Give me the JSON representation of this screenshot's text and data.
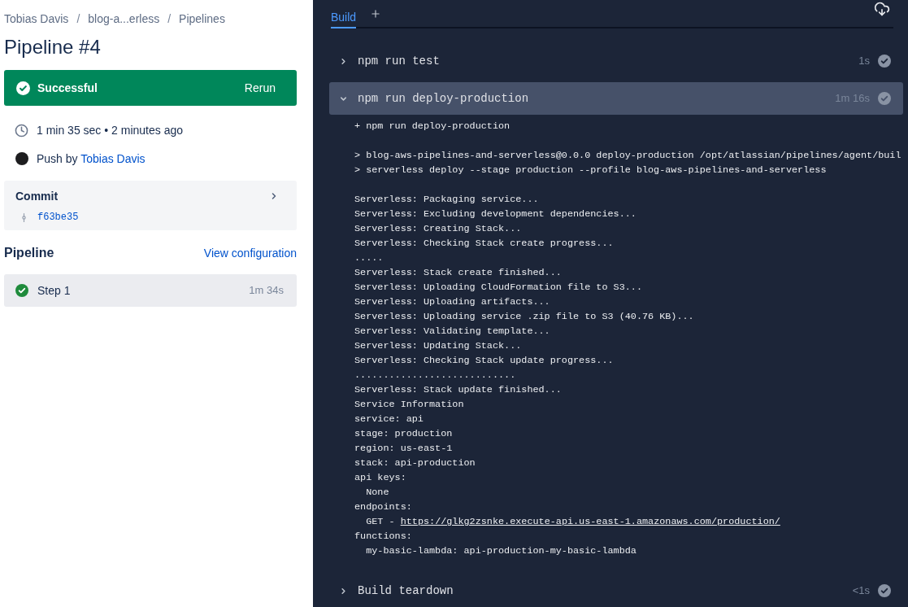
{
  "breadcrumb": [
    {
      "kind": "link",
      "label": "Tobias Davis"
    },
    {
      "kind": "separator",
      "label": "/"
    },
    {
      "kind": "link",
      "label": "blog-a...erless"
    },
    {
      "kind": "separator",
      "label": "/"
    },
    {
      "kind": "link",
      "label": "Pipelines"
    }
  ],
  "title": "Pipeline #4",
  "status": {
    "kind": "successful",
    "label": "Successful",
    "action": "Rerun"
  },
  "duration": "1 min 35 sec • 2 minutes ago",
  "trigger": {
    "text": "Push by",
    "author": "Tobias Davis"
  },
  "commit": {
    "title": "Commit",
    "hash": "f63be35"
  },
  "pipeline": {
    "title": "Pipeline",
    "link": "View configuration",
    "steps": [
      {
        "label": "Step 1",
        "duration": "1m 34s",
        "selected": true
      }
    ]
  },
  "build": {
    "tabs": [
      {
        "label": "Build",
        "selected": true
      }
    ],
    "steps": [
      {
        "name": "npm run test",
        "duration": "1s",
        "expanded": false
      },
      {
        "name": "npm run deploy-production",
        "duration": "1m 16s",
        "expanded": true,
        "log": [
          [
            {
              "text": "+ npm run deploy-production"
            }
          ],
          [
            {
              "text": "> blog-aws-pipelines-and-serverless@0.0.0 deploy-production /opt/atlassian/pipelines/agent/buil"
            },
            {
              "text": "> serverless deploy --stage production --profile blog-aws-pipelines-and-serverless"
            }
          ],
          [
            {
              "text": "Serverless: Packaging service..."
            },
            {
              "text": "Serverless: Excluding development dependencies..."
            },
            {
              "text": "Serverless: Creating Stack..."
            },
            {
              "text": "Serverless: Checking Stack create progress..."
            },
            {
              "text": "....."
            },
            {
              "text": "Serverless: Stack create finished..."
            },
            {
              "text": "Serverless: Uploading CloudFormation file to S3..."
            },
            {
              "text": "Serverless: Uploading artifacts..."
            },
            {
              "text": "Serverless: Uploading service .zip file to S3 (40.76 KB)..."
            },
            {
              "text": "Serverless: Validating template..."
            },
            {
              "text": "Serverless: Updating Stack..."
            },
            {
              "text": "Serverless: Checking Stack update progress..."
            },
            {
              "text": "............................"
            },
            {
              "text": "Serverless: Stack update finished..."
            },
            {
              "text": "Service Information"
            },
            {
              "text": "service: api"
            },
            {
              "text": "stage: production"
            },
            {
              "text": "region: us-east-1"
            },
            {
              "text": "stack: api-production"
            },
            {
              "text": "api keys:",
              "children": [
                {
                  "text": "None"
                }
              ]
            },
            {
              "text": "endpoints:",
              "children": [
                {
                  "text": "GET -",
                  "link": "https://glkg2zsnke.execute-api.us-east-1.amazonaws.com/production/"
                }
              ]
            },
            {
              "text": "functions:",
              "children": [
                {
                  "text": "my-basic-lambda: api-production-my-basic-lambda"
                }
              ]
            }
          ]
        ]
      },
      {
        "name": "Build teardown",
        "duration": "<1s",
        "expanded": false
      }
    ]
  }
}
